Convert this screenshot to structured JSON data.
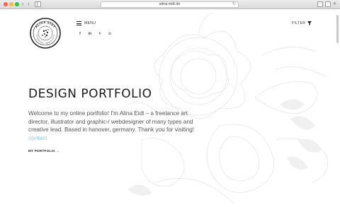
{
  "browser": {
    "url": "alina-eidt.de",
    "reload_icon": "reload-icon"
  },
  "logo": {
    "text": "ALINA EIDT",
    "subtitle": "ART DIRECTION · GRAPHIC DESIGN",
    "accent": "#222222"
  },
  "header": {
    "menu_label": "MENU",
    "filter_label": "FILTER",
    "social": [
      {
        "icon": "facebook-icon",
        "glyph": "f"
      },
      {
        "icon": "linkedin-icon",
        "glyph": "in"
      },
      {
        "icon": "share-icon",
        "glyph": "<"
      },
      {
        "icon": "instagram-icon",
        "glyph": "◘"
      }
    ]
  },
  "hero": {
    "title": "DESIGN PORTFOLIO",
    "intro_text": "Welcome to my online portfolio! I'm Alina Eidt – a freelance art director, illustrator and graphic-/ webdesigner of many types and creative lead. Based in hanover, germany. Thank you for visiting! ",
    "contact_link": "contact",
    "portfolio_link": "MY PORTFOLIO →",
    "link_color": "#7ed0df"
  }
}
